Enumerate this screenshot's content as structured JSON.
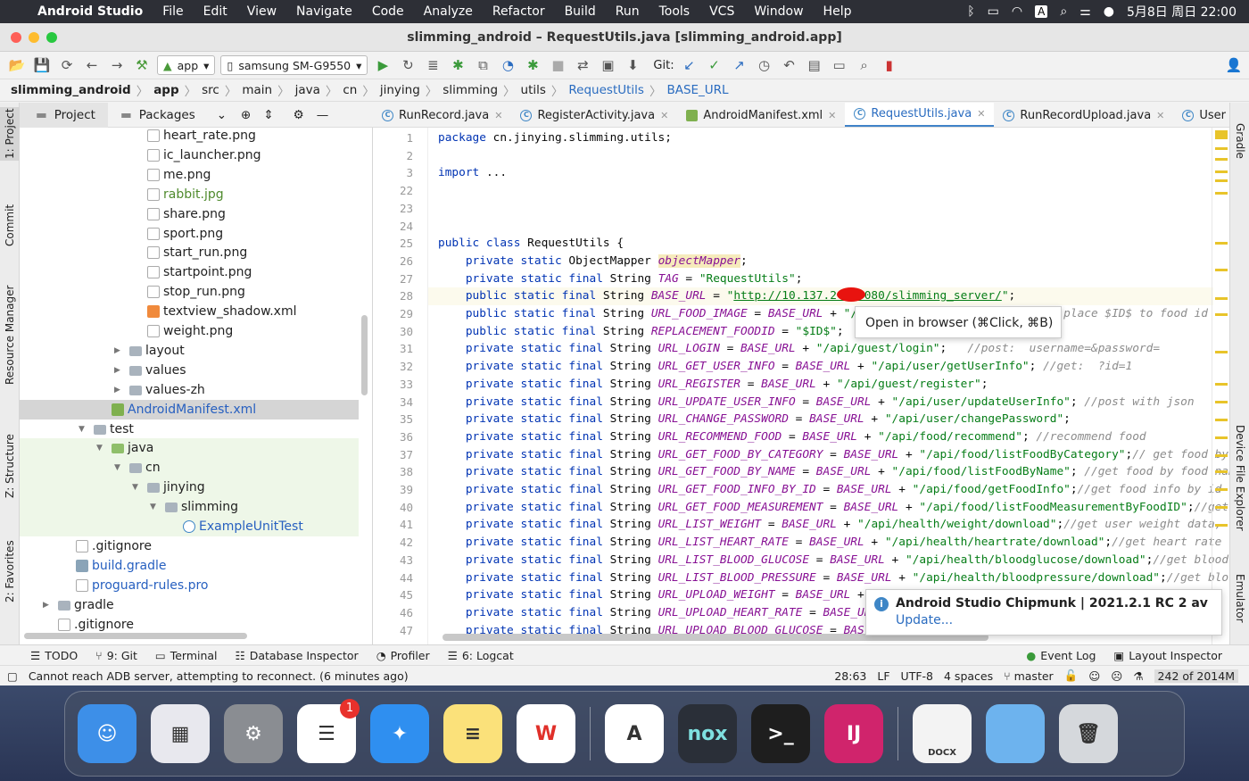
{
  "menubar": {
    "app": "Android Studio",
    "items": [
      "File",
      "Edit",
      "View",
      "Navigate",
      "Code",
      "Analyze",
      "Refactor",
      "Build",
      "Run",
      "Tools",
      "VCS",
      "Window",
      "Help"
    ],
    "clock": "5月8日 周日 22:00",
    "input_method": "A"
  },
  "window": {
    "title": "slimming_android – RequestUtils.java [slimming_android.app]"
  },
  "toolbar": {
    "run_config": "app",
    "device": "samsung SM-G9550",
    "git_label": "Git:"
  },
  "breadcrumb": [
    "slimming_android",
    "app",
    "src",
    "main",
    "java",
    "cn",
    "jinying",
    "slimming",
    "utils",
    "RequestUtils",
    "BASE_URL"
  ],
  "project_panel": {
    "tabs": [
      "Project",
      "Packages"
    ],
    "tree": [
      {
        "label": "heart_rate.png",
        "depth": 7,
        "type": "file"
      },
      {
        "label": "ic_launcher.png",
        "depth": 7,
        "type": "file"
      },
      {
        "label": "me.png",
        "depth": 7,
        "type": "file"
      },
      {
        "label": "rabbit.jpg",
        "depth": 7,
        "type": "file",
        "color": "#4f8a2d"
      },
      {
        "label": "share.png",
        "depth": 7,
        "type": "file"
      },
      {
        "label": "sport.png",
        "depth": 7,
        "type": "file"
      },
      {
        "label": "start_run.png",
        "depth": 7,
        "type": "file"
      },
      {
        "label": "startpoint.png",
        "depth": 7,
        "type": "file"
      },
      {
        "label": "stop_run.png",
        "depth": 7,
        "type": "file"
      },
      {
        "label": "textview_shadow.xml",
        "depth": 7,
        "type": "xml"
      },
      {
        "label": "weight.png",
        "depth": 7,
        "type": "file"
      },
      {
        "label": "layout",
        "depth": 6,
        "type": "folder",
        "arrow": "▶"
      },
      {
        "label": "values",
        "depth": 6,
        "type": "folder",
        "arrow": "▶"
      },
      {
        "label": "values-zh",
        "depth": 6,
        "type": "folder",
        "arrow": "▶"
      },
      {
        "label": "AndroidManifest.xml",
        "depth": 5,
        "type": "manifest",
        "color": "#2760c0",
        "selected": true
      },
      {
        "label": "test",
        "depth": 4,
        "type": "folder",
        "arrow": "▼"
      },
      {
        "label": "java",
        "depth": 5,
        "type": "testfolder",
        "arrow": "▼",
        "green": true
      },
      {
        "label": "cn",
        "depth": 6,
        "type": "folder",
        "arrow": "▼",
        "green": true
      },
      {
        "label": "jinying",
        "depth": 7,
        "type": "folder",
        "arrow": "▼",
        "green": true
      },
      {
        "label": "slimming",
        "depth": 8,
        "type": "folder",
        "arrow": "▼",
        "green": true
      },
      {
        "label": "ExampleUnitTest",
        "depth": 9,
        "type": "class",
        "color": "#2760c0",
        "green": true
      },
      {
        "label": ".gitignore",
        "depth": 3,
        "type": "file"
      },
      {
        "label": "build.gradle",
        "depth": 3,
        "type": "gradle",
        "color": "#2760c0"
      },
      {
        "label": "proguard-rules.pro",
        "depth": 3,
        "type": "file",
        "color": "#2760c0"
      },
      {
        "label": "gradle",
        "depth": 2,
        "type": "folder",
        "arrow": "▶"
      },
      {
        "label": ".gitignore",
        "depth": 2,
        "type": "file"
      }
    ]
  },
  "left_strip": [
    "1: Project",
    "Commit",
    "Resource Manager",
    "Z: Structure",
    "2: Favorites"
  ],
  "right_strip": [
    "Gradle",
    "Device File Explorer",
    "Emulator"
  ],
  "editor_tabs": [
    {
      "label": "RunRecord.java"
    },
    {
      "label": "RegisterActivity.java"
    },
    {
      "label": "AndroidManifest.xml",
      "icon": "manifest"
    },
    {
      "label": "RequestUtils.java",
      "active": true
    },
    {
      "label": "RunRecordUpload.java"
    },
    {
      "label": "User"
    }
  ],
  "code": [
    {
      "n": "1",
      "t": [
        [
          "k",
          "package "
        ],
        [
          "p",
          "cn.jinying.slimming.utils;"
        ]
      ]
    },
    {
      "n": "2",
      "t": []
    },
    {
      "n": "3",
      "t": [
        [
          "k",
          "import "
        ],
        [
          "f",
          "..."
        ]
      ]
    },
    {
      "n": "22",
      "t": []
    },
    {
      "n": "23",
      "t": []
    },
    {
      "n": "24",
      "t": []
    },
    {
      "n": "25",
      "t": [
        [
          "k",
          "public class "
        ],
        [
          "p",
          "RequestUtils {"
        ]
      ]
    },
    {
      "n": "26",
      "t": [
        [
          "k",
          "    private static "
        ],
        [
          "p",
          "ObjectMapper "
        ],
        [
          "h",
          "objectMapper"
        ],
        [
          "p",
          ";"
        ]
      ]
    },
    {
      "n": "27",
      "t": [
        [
          "k",
          "    private static final "
        ],
        [
          "p",
          "String "
        ],
        [
          "c",
          "TAG"
        ],
        [
          "p",
          " = "
        ],
        [
          "s",
          "\"RequestUtils\""
        ],
        [
          "p",
          ";"
        ]
      ]
    },
    {
      "n": "28",
      "t": [
        [
          "k",
          "    public static final "
        ],
        [
          "p",
          "String "
        ],
        [
          "c",
          "BASE_URL"
        ],
        [
          "p",
          " = "
        ],
        [
          "s",
          "\""
        ],
        [
          "u",
          "http://10.137.2   8080/slimming_server/"
        ],
        [
          "s",
          "\""
        ],
        [
          "p",
          ";"
        ]
      ],
      "current": true
    },
    {
      "n": "29",
      "t": [
        [
          "k",
          "    public static final "
        ],
        [
          "p",
          "String "
        ],
        [
          "c",
          "URL_FOOD_IMAGE"
        ],
        [
          "p",
          " = "
        ],
        [
          "c",
          "BASE_URL"
        ],
        [
          "p",
          " + "
        ],
        [
          "s",
          "\"/"
        ],
        [
          "p",
          "                              "
        ],
        [
          "m",
          "place $ID$ to food id"
        ]
      ]
    },
    {
      "n": "30",
      "t": [
        [
          "k",
          "    public static final "
        ],
        [
          "p",
          "String "
        ],
        [
          "c",
          "REPLACEMENT_FOODID"
        ],
        [
          "p",
          " = "
        ],
        [
          "s",
          "\"$ID$\""
        ],
        [
          "p",
          ";"
        ]
      ]
    },
    {
      "n": "31",
      "t": [
        [
          "k",
          "    private static final "
        ],
        [
          "p",
          "String "
        ],
        [
          "c",
          "URL_LOGIN"
        ],
        [
          "p",
          " = "
        ],
        [
          "c",
          "BASE_URL"
        ],
        [
          "p",
          " + "
        ],
        [
          "s",
          "\"/api/guest/login\""
        ],
        [
          "p",
          ";   "
        ],
        [
          "m",
          "//post:  username=&password="
        ]
      ]
    },
    {
      "n": "32",
      "t": [
        [
          "k",
          "    private static final "
        ],
        [
          "p",
          "String "
        ],
        [
          "c",
          "URL_GET_USER_INFO"
        ],
        [
          "p",
          " = "
        ],
        [
          "c",
          "BASE_URL"
        ],
        [
          "p",
          " + "
        ],
        [
          "s",
          "\"/api/user/getUserInfo\""
        ],
        [
          "p",
          "; "
        ],
        [
          "m",
          "//get:  ?id=1"
        ]
      ]
    },
    {
      "n": "33",
      "t": [
        [
          "k",
          "    private static final "
        ],
        [
          "p",
          "String "
        ],
        [
          "c",
          "URL_REGISTER"
        ],
        [
          "p",
          " = "
        ],
        [
          "c",
          "BASE_URL"
        ],
        [
          "p",
          " + "
        ],
        [
          "s",
          "\"/api/guest/register\""
        ],
        [
          "p",
          ";"
        ]
      ]
    },
    {
      "n": "34",
      "t": [
        [
          "k",
          "    private static final "
        ],
        [
          "p",
          "String "
        ],
        [
          "c",
          "URL_UPDATE_USER_INFO"
        ],
        [
          "p",
          " = "
        ],
        [
          "c",
          "BASE_URL"
        ],
        [
          "p",
          " + "
        ],
        [
          "s",
          "\"/api/user/updateUserInfo\""
        ],
        [
          "p",
          "; "
        ],
        [
          "m",
          "//post with json"
        ]
      ]
    },
    {
      "n": "35",
      "t": [
        [
          "k",
          "    private static final "
        ],
        [
          "p",
          "String "
        ],
        [
          "c",
          "URL_CHANGE_PASSWORD"
        ],
        [
          "p",
          " = "
        ],
        [
          "c",
          "BASE_URL"
        ],
        [
          "p",
          " + "
        ],
        [
          "s",
          "\"/api/user/changePassword\""
        ],
        [
          "p",
          ";"
        ]
      ]
    },
    {
      "n": "36",
      "t": [
        [
          "k",
          "    private static final "
        ],
        [
          "p",
          "String "
        ],
        [
          "c",
          "URL_RECOMMEND_FOOD"
        ],
        [
          "p",
          " = "
        ],
        [
          "c",
          "BASE_URL"
        ],
        [
          "p",
          " + "
        ],
        [
          "s",
          "\"/api/food/recommend\""
        ],
        [
          "p",
          "; "
        ],
        [
          "m",
          "//recommend food"
        ]
      ]
    },
    {
      "n": "37",
      "t": [
        [
          "k",
          "    private static final "
        ],
        [
          "p",
          "String "
        ],
        [
          "c",
          "URL_GET_FOOD_BY_CATEGORY"
        ],
        [
          "p",
          " = "
        ],
        [
          "c",
          "BASE_URL"
        ],
        [
          "p",
          " + "
        ],
        [
          "s",
          "\"/api/food/listFoodByCategory\""
        ],
        [
          "p",
          ";"
        ],
        [
          "m",
          "// get food by"
        ]
      ]
    },
    {
      "n": "38",
      "t": [
        [
          "k",
          "    private static final "
        ],
        [
          "p",
          "String "
        ],
        [
          "c",
          "URL_GET_FOOD_BY_NAME"
        ],
        [
          "p",
          " = "
        ],
        [
          "c",
          "BASE_URL"
        ],
        [
          "p",
          " + "
        ],
        [
          "s",
          "\"/api/food/listFoodByName\""
        ],
        [
          "p",
          "; "
        ],
        [
          "m",
          "//get food by food nam"
        ]
      ]
    },
    {
      "n": "39",
      "t": [
        [
          "k",
          "    private static final "
        ],
        [
          "p",
          "String "
        ],
        [
          "c",
          "URL_GET_FOOD_INFO_BY_ID"
        ],
        [
          "p",
          " = "
        ],
        [
          "c",
          "BASE_URL"
        ],
        [
          "p",
          " + "
        ],
        [
          "s",
          "\"/api/food/getFoodInfo\""
        ],
        [
          "p",
          ";"
        ],
        [
          "m",
          "//get food info by id"
        ]
      ]
    },
    {
      "n": "40",
      "t": [
        [
          "k",
          "    private static final "
        ],
        [
          "p",
          "String "
        ],
        [
          "c",
          "URL_GET_FOOD_MEASUREMENT"
        ],
        [
          "p",
          " = "
        ],
        [
          "c",
          "BASE_URL"
        ],
        [
          "p",
          " + "
        ],
        [
          "s",
          "\"/api/food/listFoodMeasurementByFoodID\""
        ],
        [
          "p",
          ";"
        ],
        [
          "m",
          "//get"
        ]
      ]
    },
    {
      "n": "41",
      "t": [
        [
          "k",
          "    private static final "
        ],
        [
          "p",
          "String "
        ],
        [
          "c",
          "URL_LIST_WEIGHT"
        ],
        [
          "p",
          " = "
        ],
        [
          "c",
          "BASE_URL"
        ],
        [
          "p",
          " + "
        ],
        [
          "s",
          "\"/api/health/weight/download\""
        ],
        [
          "p",
          ";"
        ],
        [
          "m",
          "//get user weight data,"
        ]
      ]
    },
    {
      "n": "42",
      "t": [
        [
          "k",
          "    private static final "
        ],
        [
          "p",
          "String "
        ],
        [
          "c",
          "URL_LIST_HEART_RATE"
        ],
        [
          "p",
          " = "
        ],
        [
          "c",
          "BASE_URL"
        ],
        [
          "p",
          " + "
        ],
        [
          "s",
          "\"/api/health/heartrate/download\""
        ],
        [
          "p",
          ";"
        ],
        [
          "m",
          "//get heart rate"
        ]
      ]
    },
    {
      "n": "43",
      "t": [
        [
          "k",
          "    private static final "
        ],
        [
          "p",
          "String "
        ],
        [
          "c",
          "URL_LIST_BLOOD_GLUCOSE"
        ],
        [
          "p",
          " = "
        ],
        [
          "c",
          "BASE_URL"
        ],
        [
          "p",
          " + "
        ],
        [
          "s",
          "\"/api/health/bloodglucose/download\""
        ],
        [
          "p",
          ";"
        ],
        [
          "m",
          "//get blood"
        ]
      ]
    },
    {
      "n": "44",
      "t": [
        [
          "k",
          "    private static final "
        ],
        [
          "p",
          "String "
        ],
        [
          "c",
          "URL_LIST_BLOOD_PRESSURE"
        ],
        [
          "p",
          " = "
        ],
        [
          "c",
          "BASE_URL"
        ],
        [
          "p",
          " + "
        ],
        [
          "s",
          "\"/api/health/bloodpressure/download\""
        ],
        [
          "p",
          ";"
        ],
        [
          "m",
          "//get bloc"
        ]
      ]
    },
    {
      "n": "45",
      "t": [
        [
          "k",
          "    private static final "
        ],
        [
          "p",
          "String "
        ],
        [
          "c",
          "URL_UPLOAD_WEIGHT"
        ],
        [
          "p",
          " = "
        ],
        [
          "c",
          "BASE_URL"
        ],
        [
          "p",
          " +"
        ]
      ]
    },
    {
      "n": "46",
      "t": [
        [
          "k",
          "    private static final "
        ],
        [
          "p",
          "String "
        ],
        [
          "c",
          "URL_UPLOAD_HEART_RATE"
        ],
        [
          "p",
          " = "
        ],
        [
          "c",
          "BASE_UR"
        ]
      ]
    },
    {
      "n": "47",
      "t": [
        [
          "k",
          "    private static final "
        ],
        [
          "p",
          "String "
        ],
        [
          "c",
          "URL_UPLOAD_BLOOD_GLUCOSE"
        ],
        [
          "p",
          " = "
        ],
        [
          "c",
          "BAS"
        ]
      ]
    }
  ],
  "tooltip": "Open in browser (⌘Click, ⌘B)",
  "notification": {
    "title": "Android Studio Chipmunk | 2021.2.1 RC 2 av",
    "link": "Update..."
  },
  "bottom_tabs": [
    "TODO",
    "9: Git",
    "Terminal",
    "Database Inspector",
    "Profiler",
    "6: Logcat"
  ],
  "bottom_right_tabs": [
    "Event Log",
    "Layout Inspector"
  ],
  "status": {
    "message": "Cannot reach ADB server, attempting to reconnect. (6 minutes ago)",
    "position": "28:63",
    "line_sep": "LF",
    "encoding": "UTF-8",
    "indent": "4 spaces",
    "branch": "master",
    "memory": "242 of 2014M"
  },
  "dock": [
    {
      "name": "finder",
      "bg": "#3d8fe8",
      "glyph": "☺"
    },
    {
      "name": "launchpad",
      "bg": "#e8e8ee",
      "glyph": "▦"
    },
    {
      "name": "system-preferences",
      "bg": "#8a8d92",
      "glyph": "⚙"
    },
    {
      "name": "reminders",
      "bg": "#ffffff",
      "glyph": "☰",
      "badge": "1"
    },
    {
      "name": "safari",
      "bg": "#2f8ff0",
      "glyph": "✦"
    },
    {
      "name": "notes",
      "bg": "#fbe17a",
      "glyph": "≡"
    },
    {
      "name": "wps-office",
      "bg": "#ffffff",
      "glyph": "W"
    },
    {
      "sep": true
    },
    {
      "name": "android-studio",
      "bg": "#ffffff",
      "glyph": "A"
    },
    {
      "name": "nox",
      "bg": "#2a2f38",
      "glyph": "nox"
    },
    {
      "name": "terminal",
      "bg": "#1e1e1e",
      "glyph": ">_"
    },
    {
      "name": "intellij-idea",
      "bg": "#d0246c",
      "glyph": "IJ"
    },
    {
      "sep": true
    },
    {
      "name": "docx-file",
      "bg": "#f3f3f3",
      "glyph": "DOCX"
    },
    {
      "name": "folder",
      "bg": "#6db3ee",
      "glyph": ""
    },
    {
      "name": "trash",
      "bg": "#d5d8dc",
      "glyph": "🗑"
    }
  ]
}
